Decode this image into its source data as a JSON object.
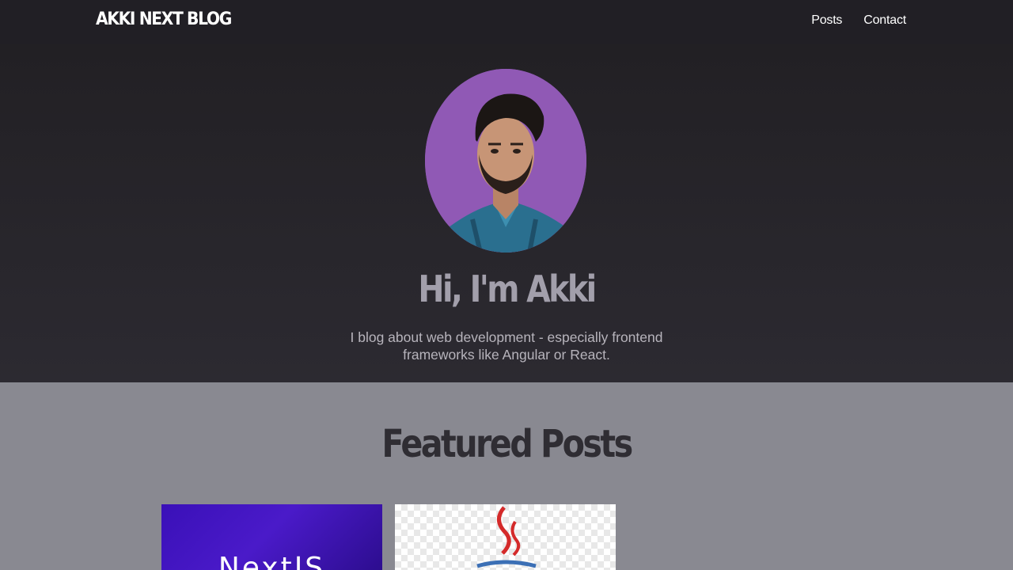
{
  "header": {
    "logo": "AKKI NEXT BLOG",
    "nav": [
      {
        "label": "Posts"
      },
      {
        "label": "Contact"
      }
    ]
  },
  "hero": {
    "avatar_icon": "person-photo",
    "title": "Hi, I'm Akki",
    "description": "I blog about web development - especially frontend frameworks like Angular or React."
  },
  "featured": {
    "title": "Featured Posts",
    "posts": [
      {
        "image_text": "NextJS",
        "image_icon": "nextjs-logo"
      },
      {
        "image_icon": "java-logo"
      }
    ]
  },
  "colors": {
    "header_bg": "#211f25",
    "hero_bg": "#28262c",
    "avatar_bg": "#9059b5",
    "section_bg": "#898991",
    "featured_title": "#2f2d33"
  }
}
